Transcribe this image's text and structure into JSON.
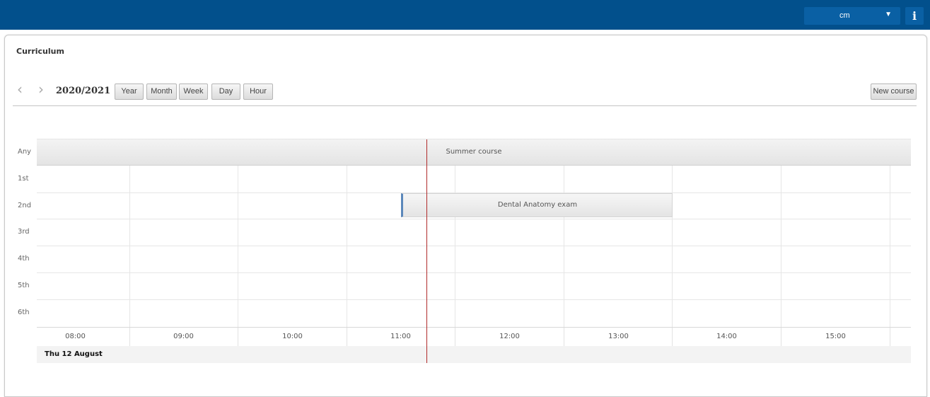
{
  "header": {
    "user_select_value": "cm",
    "info_label": "i"
  },
  "page": {
    "title": "Curriculum"
  },
  "toolbar": {
    "prev_icon": "‹",
    "next_icon": "›",
    "year": "2020/2021",
    "views": [
      "Year",
      "Month",
      "Week",
      "Day",
      "Hour"
    ],
    "new_course_label": "New course"
  },
  "calendar": {
    "rows": [
      "Any",
      "1st",
      "2nd",
      "3rd",
      "4th",
      "5th",
      "6th"
    ],
    "times": [
      "08:00",
      "09:00",
      "10:00",
      "11:00",
      "12:00",
      "13:00",
      "14:00",
      "15:00"
    ],
    "day_label": "Thu 12 August",
    "events": {
      "any": "Summer course",
      "second": "Dental Anatomy exam"
    }
  },
  "colors": {
    "topbar": "#02508c",
    "now_line": "#b02a2a",
    "event_accent": "#5b87ba"
  }
}
